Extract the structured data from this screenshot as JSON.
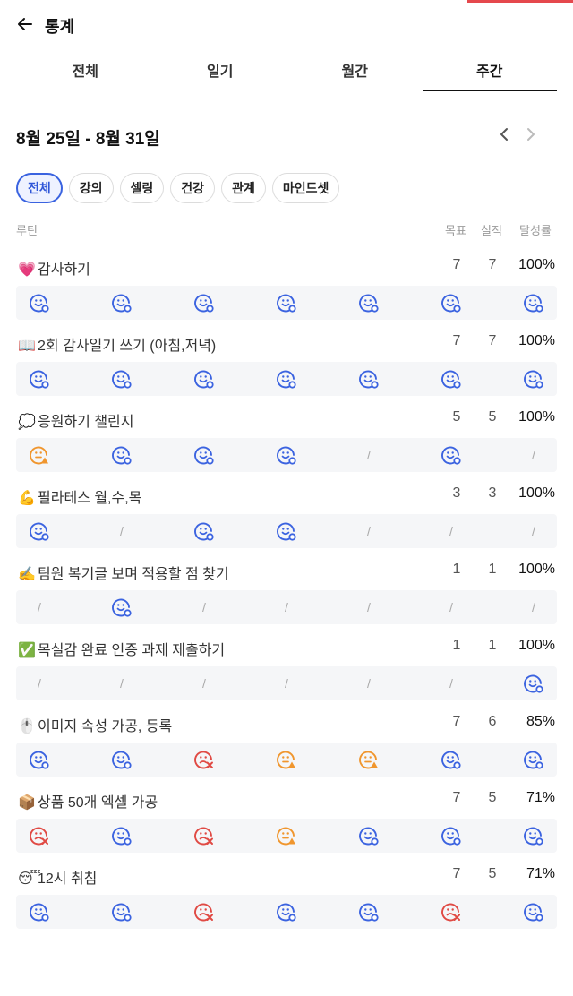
{
  "header": {
    "back_icon": "arrow-left-icon",
    "title": "통계"
  },
  "tabs": [
    {
      "label": "전체",
      "active": false
    },
    {
      "label": "일기",
      "active": false
    },
    {
      "label": "월간",
      "active": false
    },
    {
      "label": "주간",
      "active": true
    }
  ],
  "range": {
    "label": "8월 25일 - 8월 31일",
    "prev_icon": "chevron-left-icon",
    "next_icon": "chevron-right-icon"
  },
  "chips": [
    {
      "label": "전체",
      "active": true
    },
    {
      "label": "강의",
      "active": false
    },
    {
      "label": "셀링",
      "active": false
    },
    {
      "label": "건강",
      "active": false
    },
    {
      "label": "관계",
      "active": false
    },
    {
      "label": "마인드셋",
      "active": false
    }
  ],
  "columns": {
    "routine": "루틴",
    "goal": "목표",
    "actual": "실적",
    "rate": "달성률"
  },
  "colors": {
    "success": "#3b63e0",
    "partial": "#f0962e",
    "fail": "#e04a44",
    "accent": "#3a63e0"
  },
  "routines": [
    {
      "emoji": "💗",
      "name": "감사하기",
      "goal": "7",
      "actual": "7",
      "rate": "100%",
      "days": [
        "success",
        "success",
        "success",
        "success",
        "success",
        "success",
        "success"
      ]
    },
    {
      "emoji": "📖",
      "name": "2회 감사일기 쓰기 (아침,저녁)",
      "goal": "7",
      "actual": "7",
      "rate": "100%",
      "days": [
        "success",
        "success",
        "success",
        "success",
        "success",
        "success",
        "success"
      ]
    },
    {
      "emoji": "💭",
      "name": "응원하기 챌린지",
      "goal": "5",
      "actual": "5",
      "rate": "100%",
      "days": [
        "partial",
        "success",
        "success",
        "success",
        "none",
        "success",
        "none"
      ]
    },
    {
      "emoji": "💪",
      "name": "필라테스 월,수,목",
      "goal": "3",
      "actual": "3",
      "rate": "100%",
      "days": [
        "success",
        "none",
        "success",
        "success",
        "none",
        "none",
        "none"
      ]
    },
    {
      "emoji": "✍️",
      "name": "팀원 복기글 보며 적용할 점 찾기",
      "goal": "1",
      "actual": "1",
      "rate": "100%",
      "days": [
        "none",
        "success",
        "none",
        "none",
        "none",
        "none",
        "none"
      ]
    },
    {
      "emoji": "✅",
      "name": "목실감 완료 인증 과제 제출하기",
      "goal": "1",
      "actual": "1",
      "rate": "100%",
      "days": [
        "none",
        "none",
        "none",
        "none",
        "none",
        "none",
        "success"
      ]
    },
    {
      "emoji": "🖱️",
      "name": "이미지 속성 가공, 등록",
      "goal": "7",
      "actual": "6",
      "rate": "85%",
      "days": [
        "success",
        "success",
        "fail",
        "partial",
        "partial",
        "success",
        "success"
      ]
    },
    {
      "emoji": "📦",
      "name": "상품 50개 엑셀 가공",
      "goal": "7",
      "actual": "5",
      "rate": "71%",
      "days": [
        "fail",
        "success",
        "fail",
        "partial",
        "success",
        "success",
        "success"
      ]
    },
    {
      "emoji": "😴",
      "name": "12시 취침",
      "goal": "7",
      "actual": "5",
      "rate": "71%",
      "days": [
        "success",
        "success",
        "fail",
        "success",
        "success",
        "fail",
        "success"
      ]
    }
  ]
}
